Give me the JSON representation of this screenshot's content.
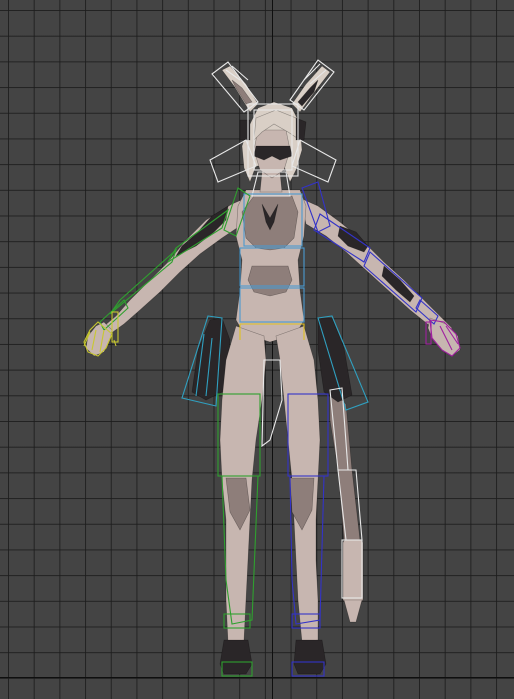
{
  "viewport": {
    "background_color": "#444444",
    "grid_line_color": "#1c1c1c",
    "world_axis_color": "#0f0f0f"
  },
  "character": {
    "skin_color": "#c7b6b0",
    "skin_shadow_color": "#8e7e7a",
    "hair_color": "#d9cfc6",
    "dark_armor_color": "#2a2628"
  },
  "rig": {
    "head_bone_color": "#e8e8e8",
    "spine_bone_color": "#4a9ad0",
    "left_arm_bone_color": "#2fa02f",
    "right_arm_bone_color": "#3333c8",
    "left_hand_bone_color": "#c8c830",
    "right_hand_bone_color": "#a020a0",
    "pelvis_bone_color": "#e0c020",
    "thigh_bone_color": "#30a0c0",
    "tail_bone_color": "#e8e8e8"
  }
}
